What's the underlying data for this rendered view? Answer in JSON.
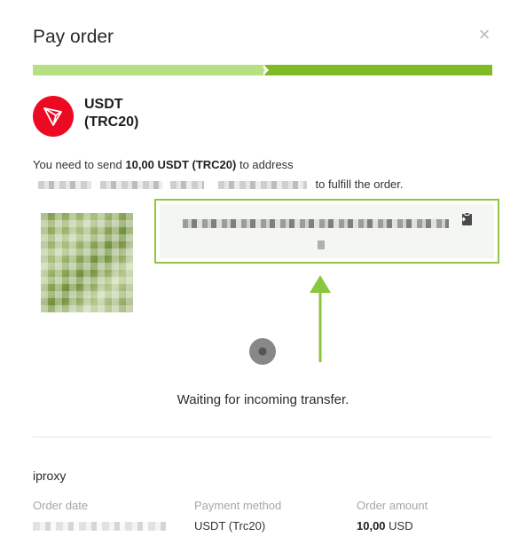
{
  "modal": {
    "title": "Pay order",
    "close_icon": "×"
  },
  "progress": {
    "steps": 2,
    "active_step": 2
  },
  "coin": {
    "name_line1": "USDT",
    "name_line2": "(TRC20)",
    "logo_icon": "tron-logo-icon",
    "logo_color": "#ec0922"
  },
  "instructions": {
    "part1": "You need to send",
    "amount": "10,00 USDT (TRC20)",
    "part2": "to address",
    "part3": "to fulfill the order."
  },
  "address": {
    "copy_icon": "clipboard-copy-icon"
  },
  "status": {
    "waiting_text": "Waiting for incoming transfer."
  },
  "order": {
    "merchant": "iproxy",
    "date_label": "Order date",
    "method_label": "Payment method",
    "method_value": "USDT (Trc20)",
    "amount_label": "Order amount",
    "amount_value": "10,00",
    "amount_currency": "USD"
  },
  "colors": {
    "progress_done": "#b7df84",
    "progress_active": "#7fbb26",
    "highlight_border": "#92c640",
    "annotation_arrow": "#8cc63f"
  }
}
